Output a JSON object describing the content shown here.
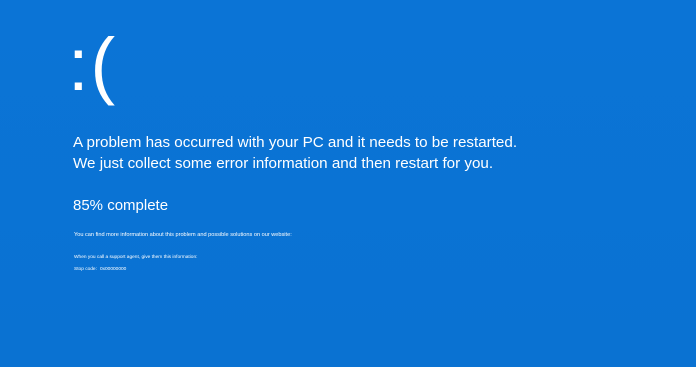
{
  "screen": {
    "background_color": "#0a73d4",
    "text_color": "#ffffff",
    "sad_face": ":(",
    "message_line1": "A problem has occurred with your PC and it needs to be restarted.",
    "message_line2": "We just collect some error information and then restart for you.",
    "progress_text": "85% complete",
    "progress_percent": 85,
    "info_text": "You can find more information about this problem and possible solutions on our website:",
    "support_text": "When you call a support agent, give them this information:",
    "stop_code_label": "Stop code:",
    "stop_code_value": "0x00000000"
  }
}
